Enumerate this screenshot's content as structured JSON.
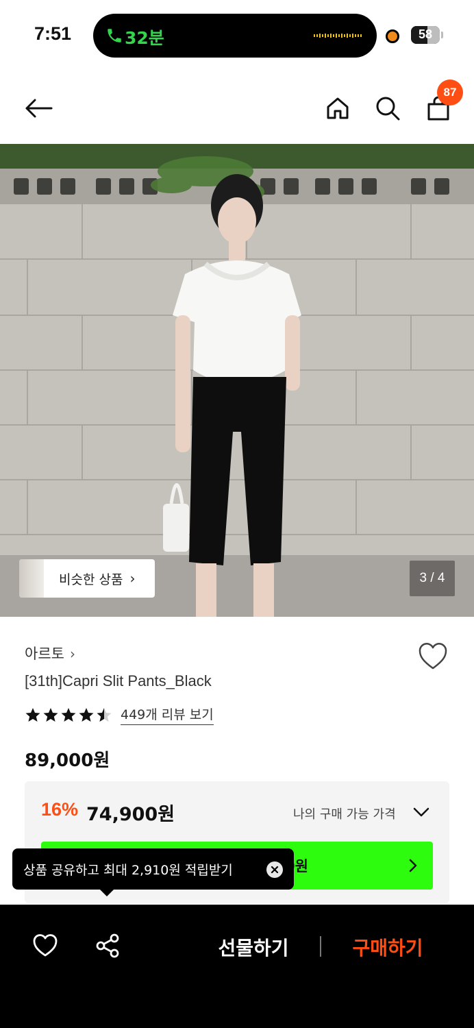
{
  "status_bar": {
    "time": "7:51",
    "call_duration": "32분",
    "battery": "58",
    "battery_level_percent": 58
  },
  "header": {
    "cart_count": "87",
    "icons": [
      "back-arrow-icon",
      "home-icon",
      "search-icon",
      "shopping-bag-icon"
    ]
  },
  "gallery": {
    "similar_label": "비슷한 상품",
    "similar_chevron": "›",
    "page_counter": "3 / 4"
  },
  "product": {
    "brand": "아르토",
    "brand_chevron": "›",
    "name": "[31th]Capri Slit Pants_Black",
    "rating_stars": 4.5,
    "reviews_label": "449개 리뷰 보기",
    "price": "89,000원",
    "discount_rate": "16%",
    "sale_price": "74,900원",
    "my_price_label": "나의 구매 가능 가격",
    "coupon_button_visible_text": "0원"
  },
  "tooltip": {
    "text": "상품 공유하고 최대 2,910원 적립받기"
  },
  "bottom_bar": {
    "gift_label": "선물하기",
    "buy_label": "구매하기"
  },
  "colors": {
    "accent": "#ff4e14",
    "green_button": "#2dfc0e",
    "call_green": "#35d44f"
  }
}
